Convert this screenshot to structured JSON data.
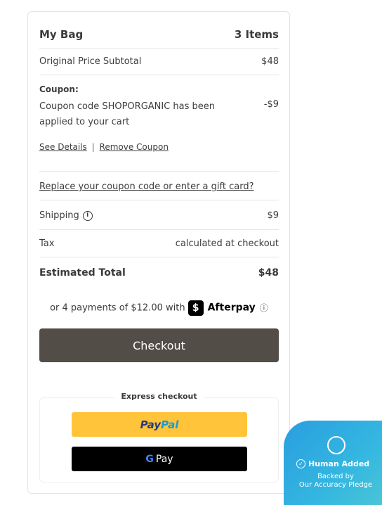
{
  "bag": {
    "title": "My Bag",
    "count": "3 Items",
    "subtotal_label": "Original Price Subtotal",
    "subtotal_value": "$48",
    "coupon_heading": "Coupon:",
    "coupon_text_line1": "Coupon code SHOPORGANIC has been",
    "coupon_text_line2": "applied to your cart",
    "coupon_value": "-$9",
    "see_details": "See Details",
    "separator": "|",
    "remove_coupon": "Remove Coupon",
    "replace_link": "Replace your coupon code or enter a gift card?",
    "shipping_label": "Shipping",
    "shipping_info": "i",
    "shipping_value": "$9",
    "tax_label": "Tax",
    "tax_value": "calculated at checkout",
    "total_label": "Estimated Total",
    "total_value": "$48"
  },
  "afterpay": {
    "text": "or 4 payments of $12.00 with",
    "logo_glyph": "$",
    "brand": "Afterpay",
    "info": "ⓘ"
  },
  "checkout": {
    "label": "Checkout"
  },
  "express": {
    "label": "Express checkout",
    "paypal_pay": "Pay",
    "paypal_pal": "Pal",
    "gpay_g": "G",
    "gpay_text": "Pay"
  },
  "badge": {
    "title": "Human Added",
    "line1": "Backed by",
    "line2": "Our Accuracy Pledge"
  },
  "colors": {
    "checkout_bg": "#524e47",
    "paypal_bg": "#ffc439",
    "paypal_dark": "#253b80",
    "paypal_light": "#179bd7",
    "badge_bg": "#2ea8e0"
  }
}
